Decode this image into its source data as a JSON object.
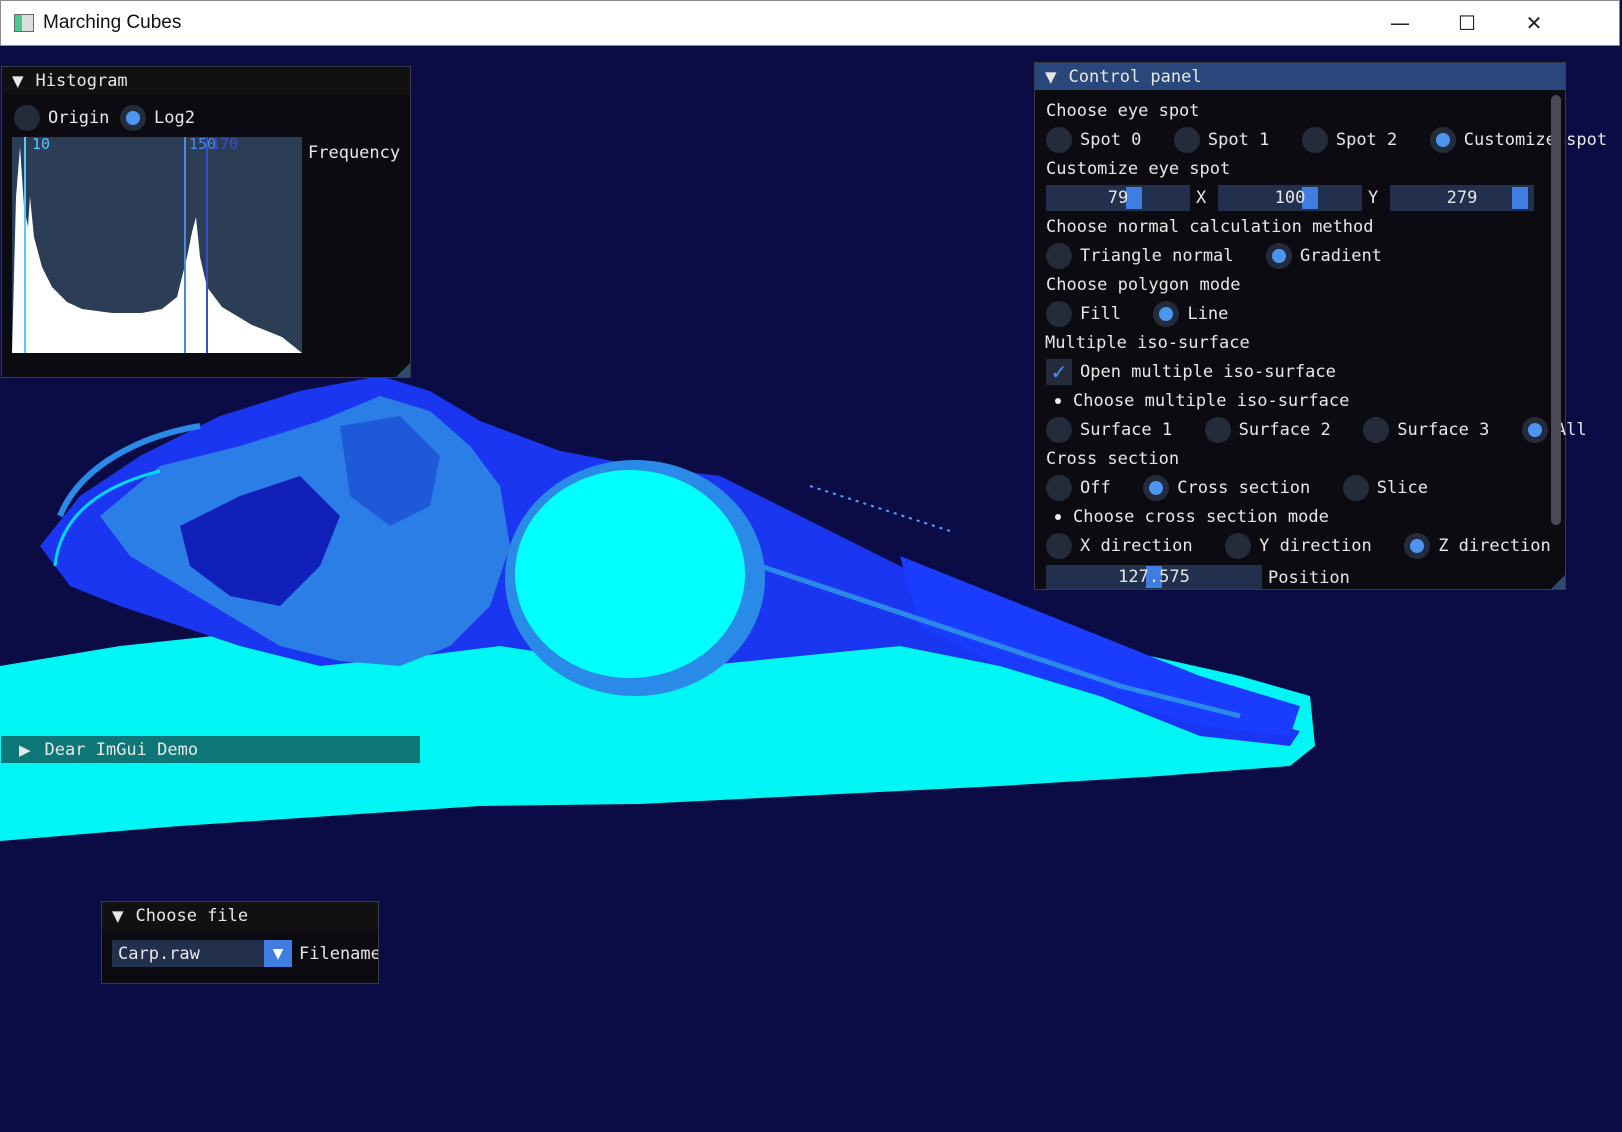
{
  "window": {
    "title": "Marching Cubes",
    "minimize": "—",
    "maximize": "☐",
    "close": "✕"
  },
  "histogram": {
    "title": "Histogram",
    "mode_origin": "Origin",
    "mode_log2": "Log2",
    "selected_mode": "Log2",
    "markers": [
      "10",
      "150",
      "170"
    ],
    "frequency_label": "Frequency"
  },
  "control_panel": {
    "title": "Control panel",
    "eye_spot": {
      "heading": "Choose eye spot",
      "options": [
        "Spot 0",
        "Spot 1",
        "Spot 2",
        "Customize spot"
      ],
      "selected": "Customize spot"
    },
    "custom_eye_spot": {
      "heading": "Customize eye spot",
      "x_value": "79",
      "x_label": "X",
      "y_value": "100",
      "y_label": "Y",
      "z_value": "279"
    },
    "normal_method": {
      "heading": "Choose normal calculation method",
      "options": [
        "Triangle normal",
        "Gradient"
      ],
      "selected": "Gradient"
    },
    "polygon_mode": {
      "heading": "Choose polygon mode",
      "options": [
        "Fill",
        "Line"
      ],
      "selected": "Line"
    },
    "multi_iso": {
      "heading": "Multiple iso-surface",
      "checkbox_label": "Open multiple iso-surface",
      "checked": true,
      "sub_heading": "Choose multiple iso-surface",
      "options": [
        "Surface 1",
        "Surface 2",
        "Surface 3",
        "All"
      ],
      "selected": "All"
    },
    "cross_section": {
      "heading": "Cross section",
      "options": [
        "Off",
        "Cross section",
        "Slice"
      ],
      "selected": "Cross section",
      "sub_heading": "Choose cross section mode",
      "directions": [
        "X direction",
        "Y direction",
        "Z direction"
      ],
      "selected_direction": "Z direction",
      "position_value": "127.575",
      "position_label": "Position"
    }
  },
  "demo_window": {
    "title": "Dear ImGui Demo"
  },
  "choose_file": {
    "title": "Choose file",
    "selected_file": "Carp.raw",
    "filename_label": "Filename"
  },
  "colors": {
    "background": "#0b0c45",
    "accent": "#4c96f2",
    "surface_cyan": "#00ffff",
    "surface_blue": "#1a3cff",
    "surface_mid": "#2a8ae8"
  }
}
